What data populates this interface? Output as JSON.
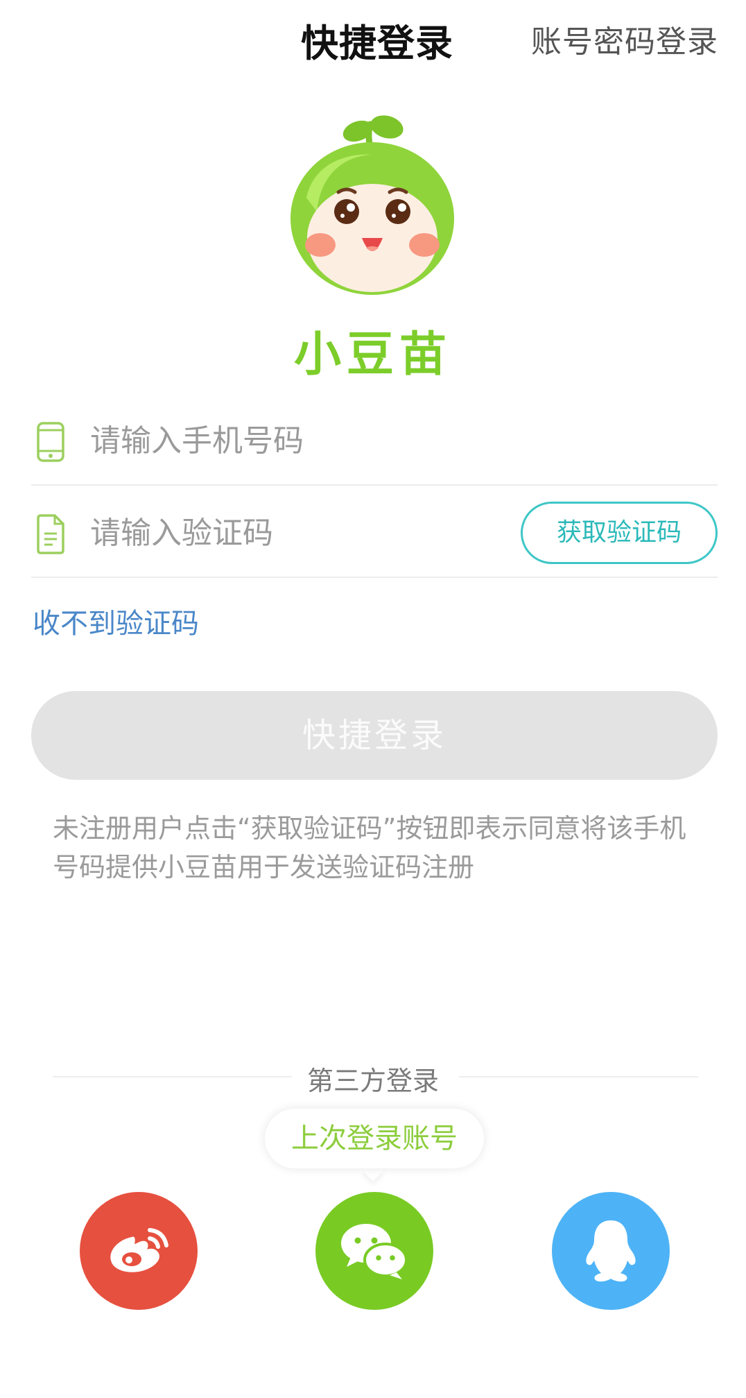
{
  "header": {
    "title": "快捷登录",
    "alt_login": "账号密码登录"
  },
  "brand": {
    "name": "小豆苗",
    "logo_icon": "sprout-mascot-logo",
    "accent_color": "#7ccd2a"
  },
  "form": {
    "phone_placeholder": "请输入手机号码",
    "phone_icon": "phone-icon",
    "code_placeholder": "请输入验证码",
    "code_icon": "document-icon",
    "get_code_label": "获取验证码",
    "no_code_link": "收不到验证码",
    "submit_label": "快捷登录"
  },
  "agreement": {
    "text": "未注册用户点击“获取验证码”按钮即表示同意将该手机号码提供小豆苗用于发送验证码注册"
  },
  "third_party": {
    "title": "第三方登录",
    "last_login_tip": "上次登录账号",
    "providers": [
      {
        "id": "weibo",
        "icon": "weibo-icon",
        "color": "#e6503f"
      },
      {
        "id": "wechat",
        "icon": "wechat-icon",
        "color": "#79cb24"
      },
      {
        "id": "qq",
        "icon": "qq-icon",
        "color": "#4db3f6"
      }
    ]
  }
}
